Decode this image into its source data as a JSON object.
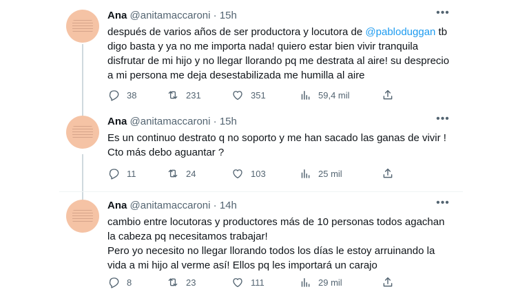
{
  "tweets": [
    {
      "name": "Ana",
      "handle": "@anitamaccaroni",
      "separator": "·",
      "time": "15h",
      "text_before": "después de varios años de ser productora y locutora de ",
      "mention": "@pabloduggan",
      "text_after": " tb digo basta y ya no me importa nada! quiero estar bien vivir tranquila disfrutar de mi hijo y no llegar llorando pq me destrata al aire! su desprecio a mi persona me deja desestabilizada me humilla al  aire",
      "replies": "38",
      "retweets": "231",
      "likes": "351",
      "views": "59,4 mil"
    },
    {
      "name": "Ana",
      "handle": "@anitamaccaroni",
      "separator": "·",
      "time": "15h",
      "text": "Es un continuo destrato q no soporto y me han sacado las ganas de vivir ! Cto más debo aguantar ?",
      "replies": "11",
      "retweets": "24",
      "likes": "103",
      "views": "25 mil"
    },
    {
      "name": "Ana",
      "handle": "@anitamaccaroni",
      "separator": "·",
      "time": "14h",
      "text_p1": "cambio entre locutoras y productores más de 10 personas todos agachan la cabeza pq necesitamos trabajar!",
      "text_p2": "Pero yo necesito no llegar llorando todos los días le estoy arruinando la vida a mi hijo al verme así! Ellos pq les importará un carajo",
      "replies": "8",
      "retweets": "23",
      "likes": "111",
      "views": "29 mil"
    }
  ],
  "icons": {
    "reply": "reply-icon",
    "retweet": "retweet-icon",
    "like": "heart-icon",
    "views": "views-chart-icon",
    "share": "share-icon",
    "more": "more-options-icon"
  },
  "colors": {
    "text": "#0f1419",
    "secondary": "#536471",
    "mention": "#1d9bf0",
    "thread_line": "#cfd9de",
    "divider": "#eff3f4",
    "avatar": "#f5c3a5"
  }
}
